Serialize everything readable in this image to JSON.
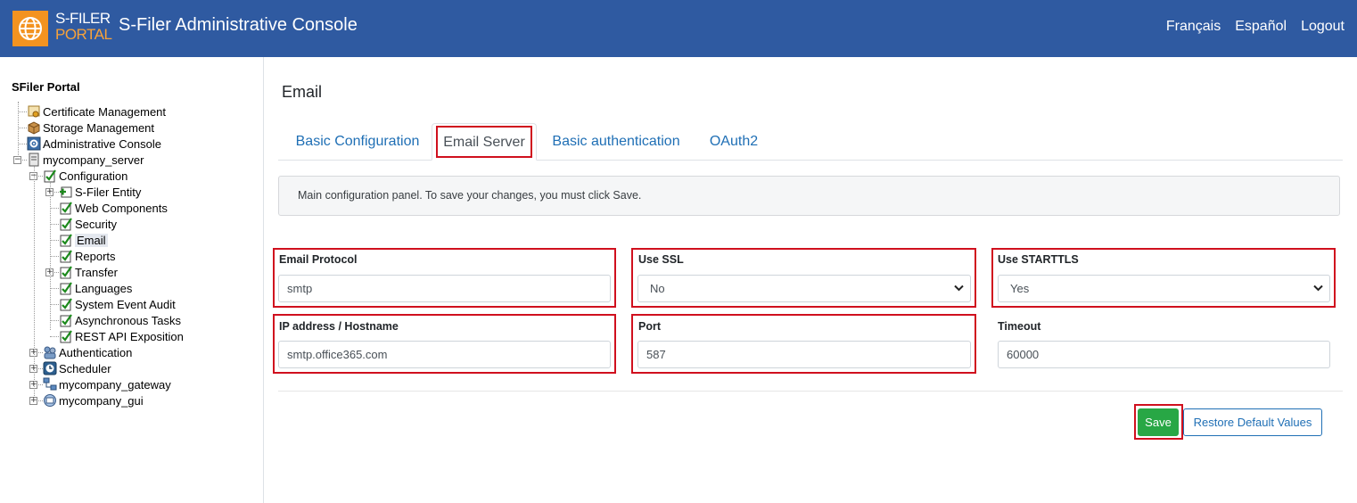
{
  "header": {
    "logo_line1": "S-FILER",
    "logo_line2": "PORTAL",
    "title": "S-Filer Administrative Console",
    "nav": [
      "Français",
      "Español",
      "Logout"
    ]
  },
  "sidebar": {
    "root": "SFiler Portal",
    "items": [
      {
        "label": "Certificate Management",
        "icon": "certificate-icon"
      },
      {
        "label": "Storage Management",
        "icon": "box-icon"
      },
      {
        "label": "Administrative Console",
        "icon": "gear-icon"
      },
      {
        "label": "mycompany_server",
        "icon": "server-icon"
      },
      {
        "label": "Configuration",
        "icon": "checklist-icon"
      },
      {
        "label": "S-Filer Entity",
        "icon": "entity-icon"
      },
      {
        "label": "Web Components",
        "icon": "checklist-icon"
      },
      {
        "label": "Security",
        "icon": "checklist-icon"
      },
      {
        "label": "Email",
        "icon": "checklist-icon"
      },
      {
        "label": "Reports",
        "icon": "checklist-icon"
      },
      {
        "label": "Transfer",
        "icon": "checklist-icon"
      },
      {
        "label": "Languages",
        "icon": "checklist-icon"
      },
      {
        "label": "System Event Audit",
        "icon": "checklist-icon"
      },
      {
        "label": "Asynchronous Tasks",
        "icon": "checklist-icon"
      },
      {
        "label": "REST API Exposition",
        "icon": "checklist-icon"
      },
      {
        "label": "Authentication",
        "icon": "users-icon"
      },
      {
        "label": "Scheduler",
        "icon": "clock-icon"
      },
      {
        "label": "mycompany_gateway",
        "icon": "network-icon"
      },
      {
        "label": "mycompany_gui",
        "icon": "gui-icon"
      }
    ],
    "selected": "Email"
  },
  "main": {
    "title": "Email",
    "tabs": [
      "Basic Configuration",
      "Email Server",
      "Basic authentication",
      "OAuth2"
    ],
    "active_tab": "Email Server",
    "info": "Main configuration panel. To save your changes, you must click Save.",
    "fields": {
      "email_protocol": {
        "label": "Email Protocol",
        "value": "smtp"
      },
      "use_ssl": {
        "label": "Use SSL",
        "value": "No"
      },
      "use_starttls": {
        "label": "Use STARTTLS",
        "value": "Yes"
      },
      "hostname": {
        "label": "IP address / Hostname",
        "value": "smtp.office365.com"
      },
      "port": {
        "label": "Port",
        "value": "587"
      },
      "timeout": {
        "label": "Timeout",
        "value": "60000"
      }
    },
    "save_label": "Save",
    "restore_label": "Restore Default Values"
  },
  "colors": {
    "header_bg": "#2f5aa1",
    "logo_orange": "#f39320",
    "link_blue": "#1f6fb5",
    "save_green": "#28a745",
    "highlight_red": "#d0101e"
  }
}
